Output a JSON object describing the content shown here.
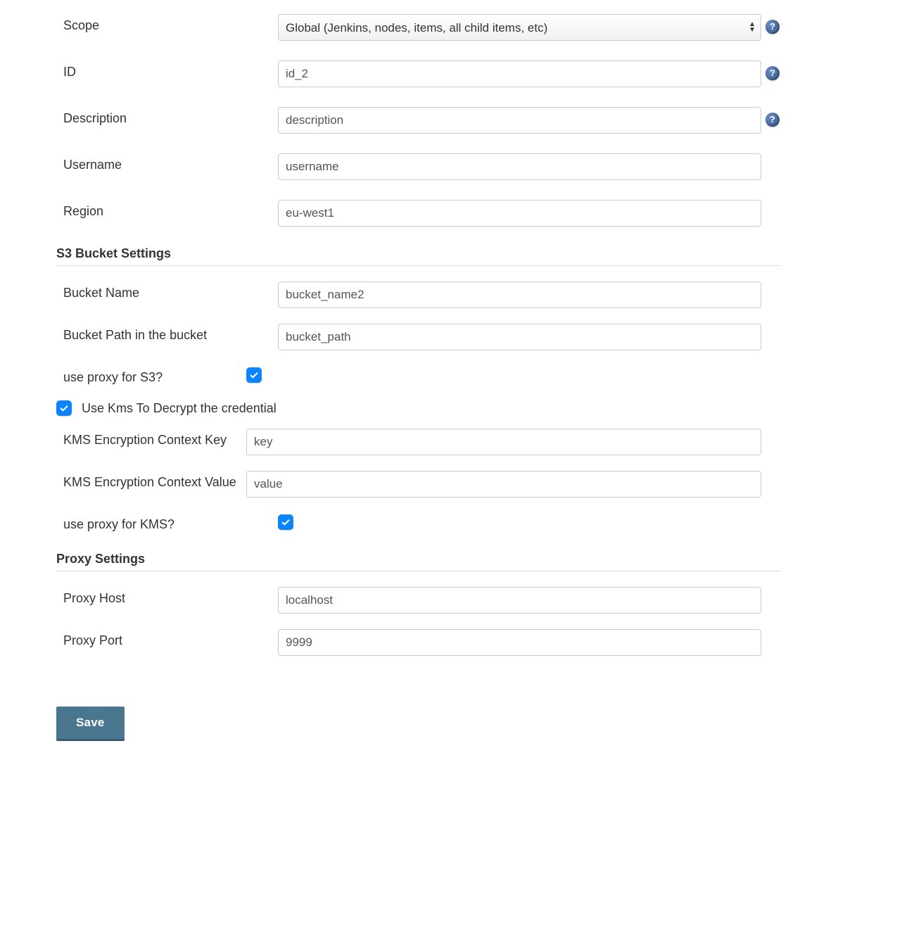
{
  "form": {
    "scope": {
      "label": "Scope",
      "value": "Global (Jenkins, nodes, items, all child items, etc)"
    },
    "id": {
      "label": "ID",
      "value": "id_2"
    },
    "description": {
      "label": "Description",
      "value": "description"
    },
    "username": {
      "label": "Username",
      "value": "username"
    },
    "region": {
      "label": "Region",
      "value": "eu-west1"
    }
  },
  "s3": {
    "heading": "S3 Bucket Settings",
    "bucket_name": {
      "label": "Bucket Name",
      "value": "bucket_name2"
    },
    "bucket_path": {
      "label": "Bucket Path in the bucket",
      "value": "bucket_path"
    },
    "use_proxy": {
      "label": "use proxy for S3?",
      "checked": true
    }
  },
  "kms": {
    "use_kms": {
      "label": "Use Kms To Decrypt the credential",
      "checked": true
    },
    "ctx_key": {
      "label": "KMS Encryption Context Key",
      "value": "key"
    },
    "ctx_value": {
      "label": "KMS Encryption Context Value",
      "value": "value"
    },
    "use_proxy": {
      "label": "use proxy for KMS?",
      "checked": true
    }
  },
  "proxy": {
    "heading": "Proxy Settings",
    "host": {
      "label": "Proxy Host",
      "value": "localhost"
    },
    "port": {
      "label": "Proxy Port",
      "value": "9999"
    }
  },
  "buttons": {
    "save": "Save"
  },
  "icons": {
    "help_glyph": "?"
  }
}
